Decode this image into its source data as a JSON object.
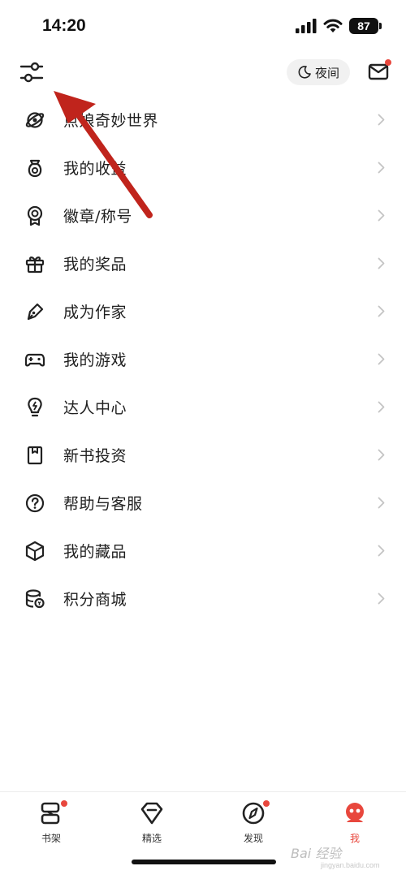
{
  "status_bar": {
    "time": "14:20",
    "battery": "87"
  },
  "header": {
    "settings_icon": "sliders-icon",
    "night_mode_label": "夜间",
    "mail_icon": "mail-icon"
  },
  "menu": {
    "items": [
      {
        "label": "点娘奇妙世界",
        "icon": "planet-icon"
      },
      {
        "label": "我的收益",
        "icon": "coin-bag-icon"
      },
      {
        "label": "徽章/称号",
        "icon": "badge-icon"
      },
      {
        "label": "我的奖品",
        "icon": "gift-icon"
      },
      {
        "label": "成为作家",
        "icon": "pen-icon"
      },
      {
        "label": "我的游戏",
        "icon": "gamepad-icon"
      },
      {
        "label": "达人中心",
        "icon": "lightbulb-icon"
      },
      {
        "label": "新书投资",
        "icon": "bookmark-icon"
      },
      {
        "label": "帮助与客服",
        "icon": "help-icon"
      },
      {
        "label": "我的藏品",
        "icon": "cube-icon"
      },
      {
        "label": "积分商城",
        "icon": "coins-icon"
      }
    ]
  },
  "tabs": [
    {
      "label": "书架",
      "icon": "bookshelf-icon",
      "badge": true,
      "active": false
    },
    {
      "label": "精选",
      "icon": "diamond-icon",
      "badge": false,
      "active": false
    },
    {
      "label": "发现",
      "icon": "compass-icon",
      "badge": true,
      "active": false
    },
    {
      "label": "我",
      "icon": "profile-avatar-icon",
      "badge": false,
      "active": true
    }
  ],
  "watermark": {
    "text": "Bai 经验",
    "sub": "jingyan.baidu.com"
  },
  "colors": {
    "accent": "#e8473d",
    "annotation_arrow": "#c0241c"
  }
}
